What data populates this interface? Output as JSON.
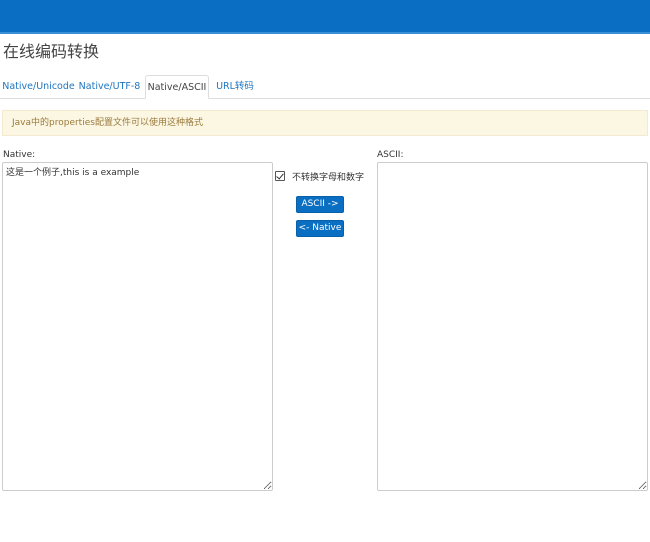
{
  "header": {
    "title": "在线编码转换"
  },
  "tabs": [
    {
      "label": "Native/Unicode",
      "active": false
    },
    {
      "label": "Native/UTF-8",
      "active": false
    },
    {
      "label": "Native/ASCII",
      "active": true
    },
    {
      "label": "URL转码",
      "active": false
    }
  ],
  "alert": {
    "text": "Java中的properties配置文件可以使用这种格式"
  },
  "native": {
    "label": "Native:",
    "value": "这是一个例子,this is a example"
  },
  "ascii": {
    "label": "ASCII:",
    "value": ""
  },
  "options": {
    "keep_alnum_label": "不转换字母和数字",
    "keep_alnum_checked": true
  },
  "buttons": {
    "to_ascii": "ASCII ->",
    "to_native": "<- Native"
  },
  "colors": {
    "brand": "#0a6fc2",
    "link": "#1e76c0",
    "alert_bg": "#fcf7e3",
    "alert_text": "#9a7a3c"
  }
}
